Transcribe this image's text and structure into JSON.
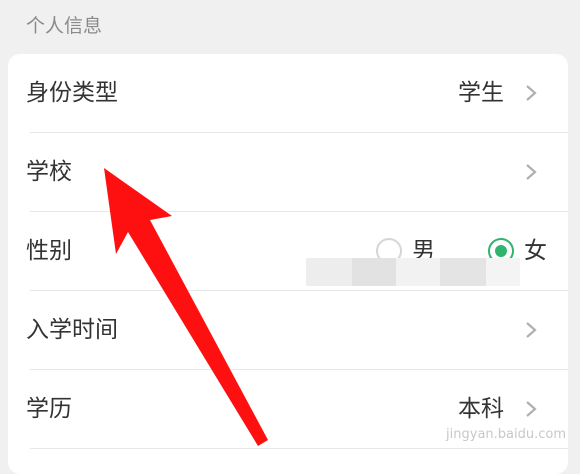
{
  "section": {
    "title": "个人信息"
  },
  "rows": {
    "identity": {
      "label": "身份类型",
      "value": "学生"
    },
    "school": {
      "label": "学校"
    },
    "gender": {
      "label": "性别",
      "options": [
        "男",
        "女"
      ],
      "selected": "女"
    },
    "enroll": {
      "label": "入学时间"
    },
    "education": {
      "label": "学历",
      "value": "本科"
    }
  },
  "watermark": "jingyan.baidu.com",
  "colors": {
    "accent": "#2fb56d",
    "arrow": "#ff1010"
  },
  "icons": {
    "chevron": "chevron-right-icon",
    "annotation": "red-arrow-annotation"
  }
}
